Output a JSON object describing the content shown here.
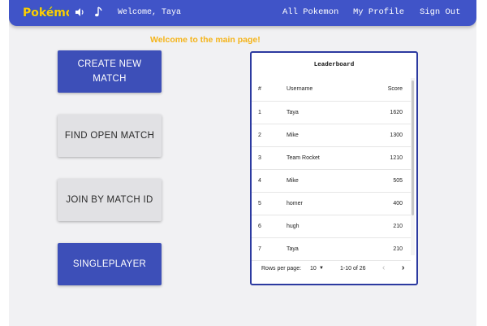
{
  "navbar": {
    "logo_text": "Pokémon",
    "welcome": "Welcome, Taya",
    "links": [
      "All Pokemon",
      "My Profile",
      "Sign Out"
    ]
  },
  "page": {
    "heading": "Welcome to the main page!"
  },
  "actions": {
    "create_line1": "CREATE NEW",
    "create_line2": "MATCH",
    "find": "FIND OPEN MATCH",
    "join": "JOIN BY MATCH ID",
    "single": "SINGLEPLAYER"
  },
  "leaderboard": {
    "title": "Leaderboard",
    "columns": [
      "#",
      "Username",
      "Score"
    ],
    "rows": [
      {
        "rank": "1",
        "username": "Taya",
        "score": "1620"
      },
      {
        "rank": "2",
        "username": "Mike",
        "score": "1300"
      },
      {
        "rank": "3",
        "username": "Team Rocket",
        "score": "1210"
      },
      {
        "rank": "4",
        "username": "Mike",
        "score": "505"
      },
      {
        "rank": "5",
        "username": "homer",
        "score": "400"
      },
      {
        "rank": "6",
        "username": "hugh",
        "score": "210"
      },
      {
        "rank": "7",
        "username": "Taya",
        "score": "210"
      }
    ],
    "footer": {
      "rows_per_page_label": "Rows per page:",
      "rows_per_page_value": "10",
      "range": "1-10 of 26"
    }
  },
  "colors": {
    "navbar": "#4054c8",
    "primary_button": "#3d4fb8",
    "secondary_button": "#e1e1e4",
    "heading": "#f4b41a",
    "leaderboard_border": "#2c3aa0"
  }
}
